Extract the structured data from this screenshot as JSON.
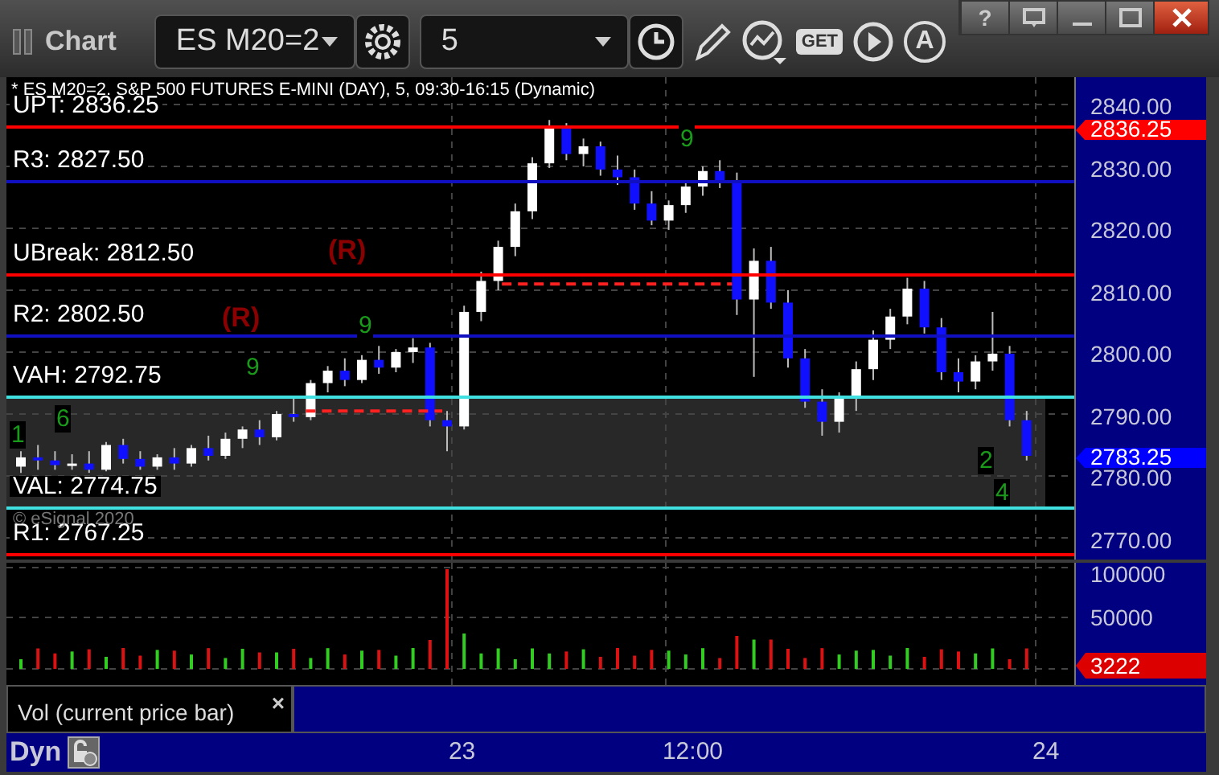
{
  "window": {
    "title": "Chart",
    "help": "?"
  },
  "toolbar": {
    "symbol": "ES M20=2",
    "interval": "5",
    "get": "GET",
    "alert": "A"
  },
  "chart": {
    "header": "* ES M20=2, S&P 500 FUTURES E-MINI (DAY), 5, 09:30-16:15 (Dynamic)",
    "levels": [
      {
        "label": "UPT: 2836.25",
        "color": "#ff0000"
      },
      {
        "label": "R3: 2827.50",
        "color": "#1010c0"
      },
      {
        "label": "UBreak: 2812.50",
        "color": "#ff0000"
      },
      {
        "label": "R2: 2802.50",
        "color": "#1010c0"
      },
      {
        "label": "VAH: 2792.75",
        "color": "#40e0e0"
      },
      {
        "label": "VAL: 2774.75",
        "color": "#40e0e0"
      },
      {
        "label": "R1: 2767.25",
        "color": "#ff0000"
      }
    ],
    "signals": [
      "(R)",
      "(R)"
    ],
    "count_marks": [
      "9",
      "9",
      "9",
      "6",
      "1",
      "2",
      "4"
    ],
    "copyright": "© eSignal 2020",
    "chart_data": {
      "type": "candlestick",
      "ylim": [
        2770,
        2840
      ],
      "grid": true,
      "yticks": [
        {
          "value": 2840,
          "label": "2840.00"
        },
        {
          "value": 2830,
          "label": "2830.00"
        },
        {
          "value": 2820,
          "label": "2820.00"
        },
        {
          "value": 2810,
          "label": "2810.00"
        },
        {
          "value": 2800,
          "label": "2800.00"
        },
        {
          "value": 2790,
          "label": "2790.00"
        },
        {
          "value": 2780,
          "label": "2780.00"
        },
        {
          "value": 2770,
          "label": "2770.00"
        }
      ],
      "ohlc": [
        [
          2781.5,
          2784,
          2780.5,
          2783
        ],
        [
          2783,
          2785,
          2781,
          2782.5
        ],
        [
          2782.5,
          2784,
          2781,
          2781.75
        ],
        [
          2781.75,
          2783.5,
          2781,
          2782
        ],
        [
          2782,
          2784,
          2780.5,
          2781
        ],
        [
          2781,
          2785.5,
          2780.75,
          2785
        ],
        [
          2785,
          2786,
          2782,
          2782.75
        ],
        [
          2782.75,
          2784,
          2781,
          2781.5
        ],
        [
          2781.5,
          2783.5,
          2781,
          2783
        ],
        [
          2783,
          2784.5,
          2781,
          2782
        ],
        [
          2782,
          2785,
          2781.5,
          2784.5
        ],
        [
          2784.5,
          2786.5,
          2782.5,
          2783.25
        ],
        [
          2783.25,
          2787,
          2782.75,
          2786
        ],
        [
          2786,
          2788,
          2784.5,
          2787.5
        ],
        [
          2787.5,
          2789,
          2785,
          2786.25
        ],
        [
          2786.25,
          2790.5,
          2785.75,
          2790
        ],
        [
          2790,
          2792.5,
          2788.75,
          2789.5
        ],
        [
          2789.5,
          2795.5,
          2789,
          2795
        ],
        [
          2795,
          2797.75,
          2793.5,
          2797
        ],
        [
          2797,
          2799,
          2794.5,
          2795.5
        ],
        [
          2795.5,
          2799.5,
          2795,
          2798.75
        ],
        [
          2798.75,
          2801,
          2796.5,
          2797.5
        ],
        [
          2797.5,
          2800.5,
          2796.75,
          2800
        ],
        [
          2800,
          2802.25,
          2798.25,
          2800.75
        ],
        [
          2800.75,
          2801.5,
          2788,
          2789
        ],
        [
          2789,
          2790.5,
          2784,
          2788
        ],
        [
          2788,
          2807.5,
          2787.5,
          2806.5
        ],
        [
          2806.5,
          2813,
          2805,
          2811.5
        ],
        [
          2811.5,
          2818,
          2810,
          2817
        ],
        [
          2817,
          2824,
          2815.5,
          2822.75
        ],
        [
          2822.75,
          2831.5,
          2821.5,
          2830.5
        ],
        [
          2830.5,
          2837.5,
          2829.75,
          2836.25
        ],
        [
          2836.25,
          2837,
          2831,
          2832
        ],
        [
          2832,
          2834.5,
          2830,
          2833.25
        ],
        [
          2833.25,
          2834,
          2828.5,
          2829.5
        ],
        [
          2829.5,
          2831.75,
          2827,
          2828.25
        ],
        [
          2828.25,
          2829.5,
          2823,
          2824
        ],
        [
          2824,
          2826,
          2820.5,
          2821.25
        ],
        [
          2821.25,
          2824.5,
          2819.75,
          2823.75
        ],
        [
          2823.75,
          2827.5,
          2822.5,
          2826.75
        ],
        [
          2826.75,
          2830,
          2825.25,
          2829.25
        ],
        [
          2829.25,
          2831,
          2826.5,
          2827.75
        ],
        [
          2827.75,
          2829,
          2806,
          2808.5
        ],
        [
          2808.5,
          2816.75,
          2796,
          2814.75
        ],
        [
          2814.75,
          2817,
          2807,
          2808
        ],
        [
          2808,
          2810,
          2797.5,
          2799
        ],
        [
          2799,
          2800.5,
          2791,
          2792
        ],
        [
          2792,
          2794,
          2786.5,
          2788.75
        ],
        [
          2788.75,
          2793.5,
          2787,
          2792.5
        ],
        [
          2792.5,
          2798.5,
          2790.5,
          2797.25
        ],
        [
          2797.25,
          2803.5,
          2795.5,
          2802
        ],
        [
          2802,
          2807,
          2800.5,
          2805.75
        ],
        [
          2805.75,
          2812,
          2804.5,
          2810.25
        ],
        [
          2810.25,
          2811.5,
          2803,
          2804
        ],
        [
          2804,
          2805.5,
          2795.5,
          2796.75
        ],
        [
          2796.75,
          2799,
          2793.5,
          2795.25
        ],
        [
          2795.25,
          2799.5,
          2794,
          2798.5
        ],
        [
          2798.5,
          2806.5,
          2797,
          2799.75
        ],
        [
          2799.75,
          2801,
          2788,
          2789
        ],
        [
          2789,
          2790.5,
          2782.5,
          2783.25
        ]
      ]
    },
    "price_badges": [
      {
        "text": "2836.25",
        "color": "#ff0000"
      },
      {
        "text": "2783.25",
        "color": "#0000ff"
      }
    ]
  },
  "volume": {
    "y_axis": [
      "100000",
      "50000"
    ],
    "badge": "3222",
    "legend": "Vol (current price bar)",
    "close": "×"
  },
  "bottom_bar": {
    "mode": "Dyn",
    "time_labels": [
      "23",
      "12:00",
      "24"
    ]
  }
}
